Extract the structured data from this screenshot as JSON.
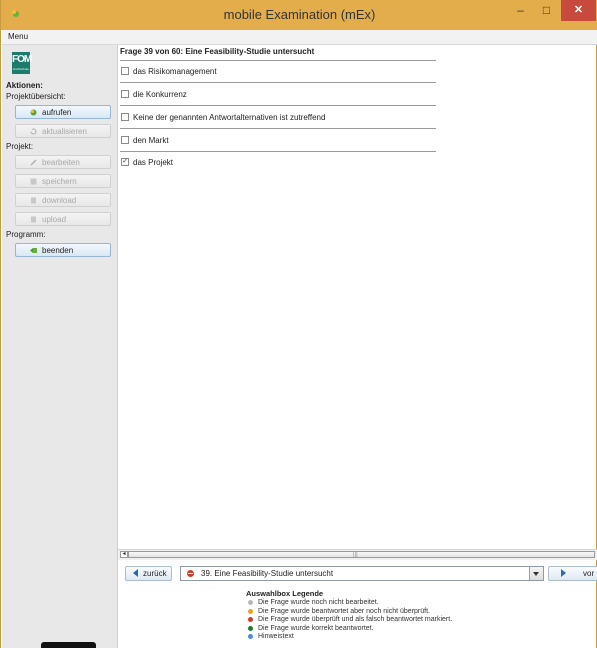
{
  "window": {
    "title": "mobile Examination (mEx)",
    "min_symbol": "–",
    "max_symbol": "□",
    "close_symbol": "✕"
  },
  "menu": {
    "label": "Menu"
  },
  "logo": {
    "text": "FOM",
    "subtext": "Hochschule"
  },
  "sidebar": {
    "aktionen_label": "Aktionen:",
    "projektuebersicht_label": "Projektübersicht:",
    "aufrufen": "aufrufen",
    "aktualisieren": "aktualisieren",
    "projekt_label": "Projekt:",
    "bearbeiten": "bearbeiten",
    "speichern": "speichern",
    "download": "download",
    "upload": "upload",
    "programm_label": "Programm:",
    "beenden": "beenden"
  },
  "question": {
    "header": "Frage 39 von 60: Eine Feasibility-Studie untersucht",
    "options": [
      {
        "label": "das Risikomanagement",
        "checked": false
      },
      {
        "label": "die Konkurrenz",
        "checked": false
      },
      {
        "label": "Keine der genannten Antwortalternativen ist zutreffend",
        "checked": false
      },
      {
        "label": "den Markt",
        "checked": false
      },
      {
        "label": "das Projekt",
        "checked": true
      }
    ]
  },
  "nav": {
    "back": "zurück",
    "forward": "vor",
    "selected_question": "39. Eine Feasibility-Studie untersucht",
    "scroll_grip": "|||"
  },
  "legend": {
    "title": "Auswahlbox Legende",
    "items": [
      {
        "text": "Die Frage wurde noch nicht bearbeitet.",
        "color": "#b9b9b9"
      },
      {
        "text": "Die Frage wurde beantwortet aber noch nicht überprüft.",
        "color": "#e8a21c"
      },
      {
        "text": "Die Frage wurde überprüft und als falsch beantwortet markiert.",
        "color": "#d43a2a"
      },
      {
        "text": "Die Frage wurde korrekt beantwortet.",
        "color": "#1a7d2a"
      },
      {
        "text": "Hinweistext",
        "color": "#4a8fd0"
      }
    ]
  }
}
